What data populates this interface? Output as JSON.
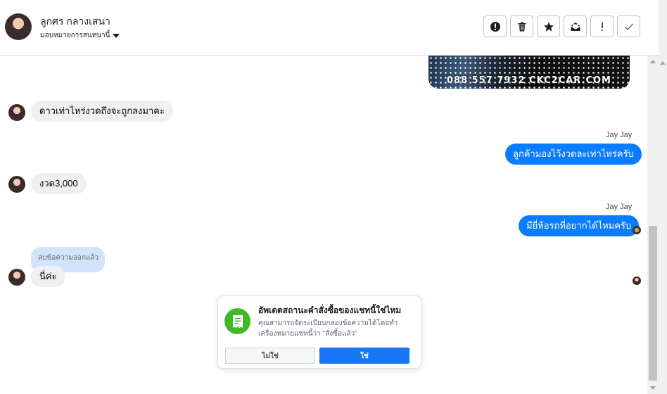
{
  "header": {
    "name": "ลูกศร กลางเสนา",
    "assign_label": "มอบหมายการสนทนานี้",
    "toolbar": [
      {
        "name": "spam-button",
        "icon": "alert-circle-icon"
      },
      {
        "name": "delete-button",
        "icon": "trash-icon"
      },
      {
        "name": "star-button",
        "icon": "star-icon"
      },
      {
        "name": "mark-unread-button",
        "icon": "envelope-icon"
      },
      {
        "name": "follow-up-button",
        "icon": "exclamation-icon"
      },
      {
        "name": "done-button",
        "icon": "check-icon"
      }
    ]
  },
  "attachment": {
    "caption": "088 557 7932 CKC2CAR.COM"
  },
  "messages": {
    "m1": "ดาวเท่าไหร่งวดถึงจะถูกลงมาคะ",
    "m2_sender": "Jay Jay",
    "m2": "ลูกค้ามองไว้งวดละเท่าไหร่ครับ",
    "m3": "งวด3,000",
    "m4_sender": "Jay Jay",
    "m4": "มียี่ห้อรถที่อยากได้ไหมครับ",
    "removed": "ลบข้อความออกแล้ว",
    "m5": "นี่ค่ะ"
  },
  "prompt": {
    "title": "อัพเดตสถานะคำสั่งซื้อของแชทนี้ใช่ไหม",
    "description": "คุณสามารถจัดระเบียบกล่องข้อความได้โดยทำเครื่องหมายแชทนี้ว่า \"สั่งซื้อแล้ว\"",
    "no_label": "ไม่ใช่",
    "yes_label": "ใช่"
  },
  "colors": {
    "outgoing_bubble": "#0a7cff",
    "incoming_bubble": "#f0f0f0",
    "removed_bubble": "#d2e4fb",
    "primary_button": "#1877f2",
    "order_icon_bg": "#42b72a"
  }
}
